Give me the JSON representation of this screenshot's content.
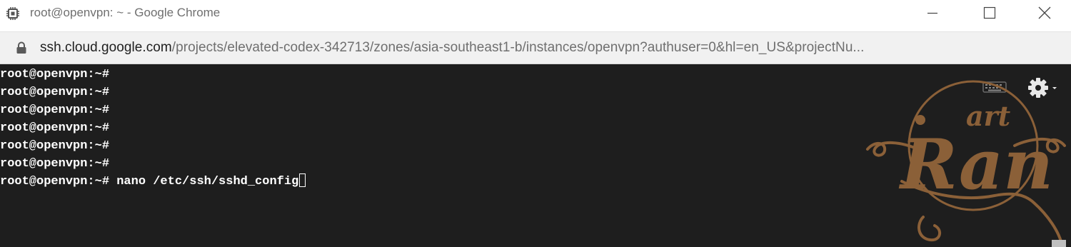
{
  "window": {
    "title": "root@openvpn: ~ - Google Chrome",
    "controls": [
      "minimize",
      "maximize",
      "close"
    ]
  },
  "address_bar": {
    "host": "ssh.cloud.google.com",
    "path": "/projects/elevated-codex-342713/zones/asia-southeast1-b/instances/openvpn?authuser=0&hl=en_US&projectNu..."
  },
  "terminal": {
    "background": "#1e1e1e",
    "prompt": "root@openvpn:~#",
    "lines": [
      "root@openvpn:~#",
      "root@openvpn:~#",
      "root@openvpn:~#",
      "root@openvpn:~#",
      "root@openvpn:~#",
      "root@openvpn:~#",
      "root@openvpn:~# nano /etc/ssh/sshd_config"
    ],
    "toolbar_icons": [
      "keyboard-icon",
      "settings-gear-icon"
    ]
  },
  "watermark": {
    "small_text": "art",
    "large_text": "Ran",
    "color": "#8b6038"
  }
}
